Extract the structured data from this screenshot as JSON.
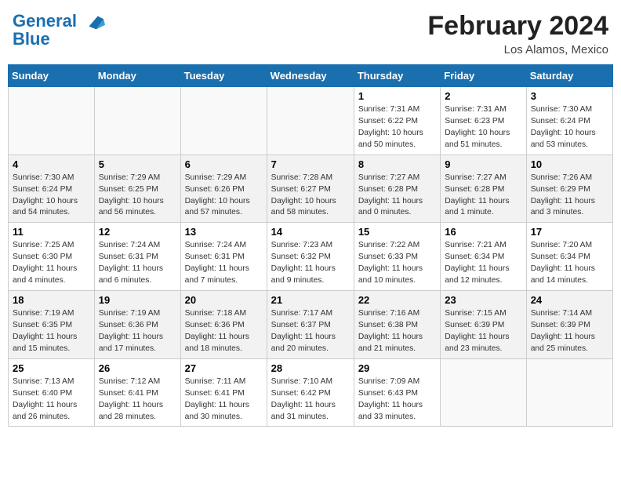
{
  "header": {
    "logo_line1": "General",
    "logo_line2": "Blue",
    "month_year": "February 2024",
    "location": "Los Alamos, Mexico"
  },
  "days_of_week": [
    "Sunday",
    "Monday",
    "Tuesday",
    "Wednesday",
    "Thursday",
    "Friday",
    "Saturday"
  ],
  "weeks": [
    [
      {
        "day": "",
        "info": ""
      },
      {
        "day": "",
        "info": ""
      },
      {
        "day": "",
        "info": ""
      },
      {
        "day": "",
        "info": ""
      },
      {
        "day": "1",
        "info": "Sunrise: 7:31 AM\nSunset: 6:22 PM\nDaylight: 10 hours and 50 minutes."
      },
      {
        "day": "2",
        "info": "Sunrise: 7:31 AM\nSunset: 6:23 PM\nDaylight: 10 hours and 51 minutes."
      },
      {
        "day": "3",
        "info": "Sunrise: 7:30 AM\nSunset: 6:24 PM\nDaylight: 10 hours and 53 minutes."
      }
    ],
    [
      {
        "day": "4",
        "info": "Sunrise: 7:30 AM\nSunset: 6:24 PM\nDaylight: 10 hours and 54 minutes."
      },
      {
        "day": "5",
        "info": "Sunrise: 7:29 AM\nSunset: 6:25 PM\nDaylight: 10 hours and 56 minutes."
      },
      {
        "day": "6",
        "info": "Sunrise: 7:29 AM\nSunset: 6:26 PM\nDaylight: 10 hours and 57 minutes."
      },
      {
        "day": "7",
        "info": "Sunrise: 7:28 AM\nSunset: 6:27 PM\nDaylight: 10 hours and 58 minutes."
      },
      {
        "day": "8",
        "info": "Sunrise: 7:27 AM\nSunset: 6:28 PM\nDaylight: 11 hours and 0 minutes."
      },
      {
        "day": "9",
        "info": "Sunrise: 7:27 AM\nSunset: 6:28 PM\nDaylight: 11 hours and 1 minute."
      },
      {
        "day": "10",
        "info": "Sunrise: 7:26 AM\nSunset: 6:29 PM\nDaylight: 11 hours and 3 minutes."
      }
    ],
    [
      {
        "day": "11",
        "info": "Sunrise: 7:25 AM\nSunset: 6:30 PM\nDaylight: 11 hours and 4 minutes."
      },
      {
        "day": "12",
        "info": "Sunrise: 7:24 AM\nSunset: 6:31 PM\nDaylight: 11 hours and 6 minutes."
      },
      {
        "day": "13",
        "info": "Sunrise: 7:24 AM\nSunset: 6:31 PM\nDaylight: 11 hours and 7 minutes."
      },
      {
        "day": "14",
        "info": "Sunrise: 7:23 AM\nSunset: 6:32 PM\nDaylight: 11 hours and 9 minutes."
      },
      {
        "day": "15",
        "info": "Sunrise: 7:22 AM\nSunset: 6:33 PM\nDaylight: 11 hours and 10 minutes."
      },
      {
        "day": "16",
        "info": "Sunrise: 7:21 AM\nSunset: 6:34 PM\nDaylight: 11 hours and 12 minutes."
      },
      {
        "day": "17",
        "info": "Sunrise: 7:20 AM\nSunset: 6:34 PM\nDaylight: 11 hours and 14 minutes."
      }
    ],
    [
      {
        "day": "18",
        "info": "Sunrise: 7:19 AM\nSunset: 6:35 PM\nDaylight: 11 hours and 15 minutes."
      },
      {
        "day": "19",
        "info": "Sunrise: 7:19 AM\nSunset: 6:36 PM\nDaylight: 11 hours and 17 minutes."
      },
      {
        "day": "20",
        "info": "Sunrise: 7:18 AM\nSunset: 6:36 PM\nDaylight: 11 hours and 18 minutes."
      },
      {
        "day": "21",
        "info": "Sunrise: 7:17 AM\nSunset: 6:37 PM\nDaylight: 11 hours and 20 minutes."
      },
      {
        "day": "22",
        "info": "Sunrise: 7:16 AM\nSunset: 6:38 PM\nDaylight: 11 hours and 21 minutes."
      },
      {
        "day": "23",
        "info": "Sunrise: 7:15 AM\nSunset: 6:39 PM\nDaylight: 11 hours and 23 minutes."
      },
      {
        "day": "24",
        "info": "Sunrise: 7:14 AM\nSunset: 6:39 PM\nDaylight: 11 hours and 25 minutes."
      }
    ],
    [
      {
        "day": "25",
        "info": "Sunrise: 7:13 AM\nSunset: 6:40 PM\nDaylight: 11 hours and 26 minutes."
      },
      {
        "day": "26",
        "info": "Sunrise: 7:12 AM\nSunset: 6:41 PM\nDaylight: 11 hours and 28 minutes."
      },
      {
        "day": "27",
        "info": "Sunrise: 7:11 AM\nSunset: 6:41 PM\nDaylight: 11 hours and 30 minutes."
      },
      {
        "day": "28",
        "info": "Sunrise: 7:10 AM\nSunset: 6:42 PM\nDaylight: 11 hours and 31 minutes."
      },
      {
        "day": "29",
        "info": "Sunrise: 7:09 AM\nSunset: 6:43 PM\nDaylight: 11 hours and 33 minutes."
      },
      {
        "day": "",
        "info": ""
      },
      {
        "day": "",
        "info": ""
      }
    ]
  ]
}
